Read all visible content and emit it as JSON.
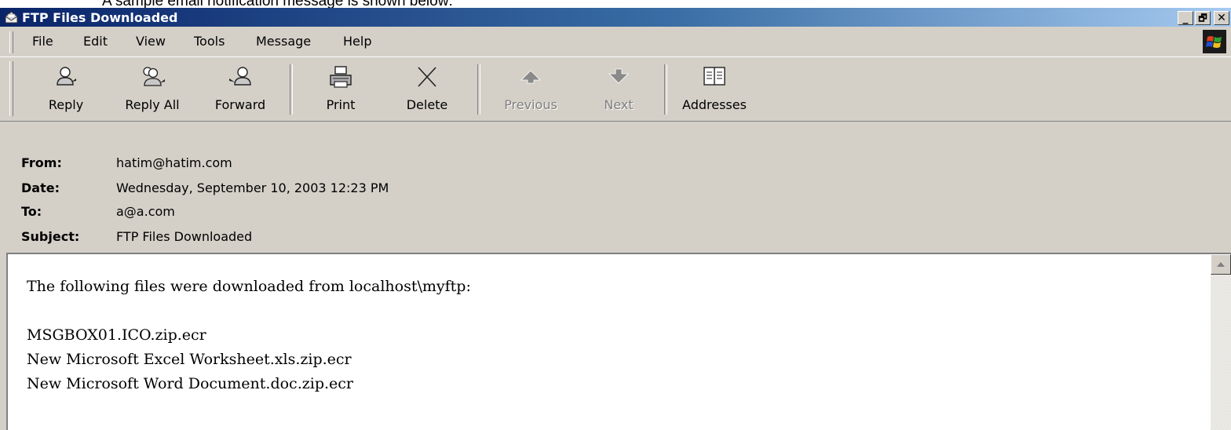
{
  "caption": "A sample email notification message is shown below:",
  "window": {
    "title": "FTP Files Downloaded",
    "controls": {
      "minimize": "_",
      "restore": "🗗",
      "close": "✕"
    }
  },
  "menu": [
    "File",
    "Edit",
    "View",
    "Tools",
    "Message",
    "Help"
  ],
  "toolbar": [
    {
      "label": "Reply",
      "icon": "reply-icon",
      "enabled": true
    },
    {
      "label": "Reply All",
      "icon": "reply-all-icon",
      "enabled": true
    },
    {
      "label": "Forward",
      "icon": "forward-icon",
      "enabled": true
    },
    {
      "label": "Print",
      "icon": "printer-icon",
      "enabled": true
    },
    {
      "label": "Delete",
      "icon": "delete-x-icon",
      "enabled": true
    },
    {
      "label": "Previous",
      "icon": "up-arrow-icon",
      "enabled": false
    },
    {
      "label": "Next",
      "icon": "down-arrow-icon",
      "enabled": false
    },
    {
      "label": "Addresses",
      "icon": "address-book-icon",
      "enabled": true
    }
  ],
  "headers": {
    "from_label": "From:",
    "from": "hatim@hatim.com",
    "date_label": "Date:",
    "date": "Wednesday, September 10, 2003 12:23 PM",
    "to_label": "To:",
    "to": "a@a.com",
    "subject_label": "Subject:",
    "subject": "FTP Files Downloaded"
  },
  "body": {
    "intro": "The following files were downloaded from localhost\\myftp:",
    "files": [
      "MSGBOX01.ICO.zip.ecr",
      "New Microsoft Excel Worksheet.xls.zip.ecr",
      "New Microsoft Word Document.doc.zip.ecr"
    ]
  },
  "colors": {
    "title_gradient_start": "#0a246a",
    "title_gradient_end": "#a6caf0",
    "face": "#d4d0c8"
  }
}
